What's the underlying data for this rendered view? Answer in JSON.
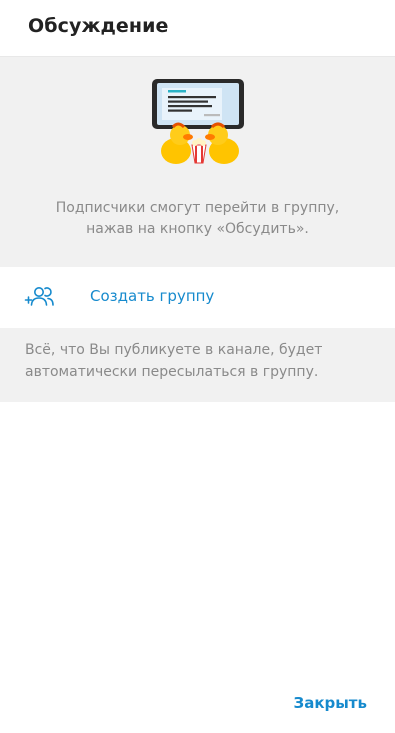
{
  "header": {
    "title": "Обсуждение"
  },
  "hero": {
    "illustration_icon": "ducks-watching-screen-icon",
    "description": "Подписчики смогут перейти в группу, нажав на кнопку «Обсудить»."
  },
  "create_group": {
    "icon": "add-group-icon",
    "label": "Создать группу"
  },
  "info": {
    "text": "Всё, что Вы публикуете в канале, будет автоматически пересылаться в группу."
  },
  "actions": {
    "close_label": "Закрыть"
  },
  "colors": {
    "accent": "#168acd",
    "muted_text": "#8a8a8a",
    "section_bg": "#f1f1f1"
  }
}
